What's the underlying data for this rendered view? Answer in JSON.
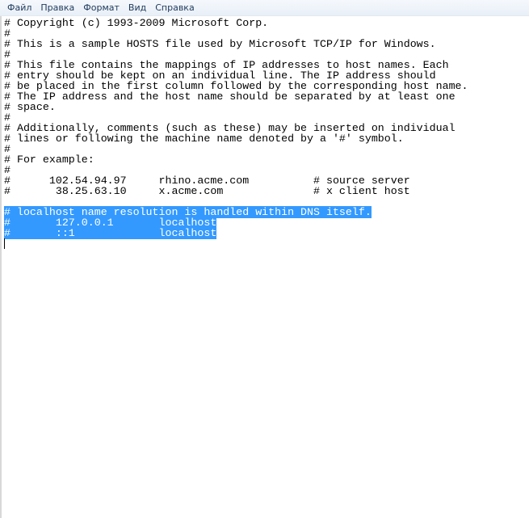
{
  "menu": [
    "Файл",
    "Правка",
    "Формат",
    "Вид",
    "Справка"
  ],
  "lines": [
    "# Copyright (c) 1993-2009 Microsoft Corp.",
    "#",
    "# This is a sample HOSTS file used by Microsoft TCP/IP for Windows.",
    "#",
    "# This file contains the mappings of IP addresses to host names. Each",
    "# entry should be kept on an individual line. The IP address should",
    "# be placed in the first column followed by the corresponding host name.",
    "# The IP address and the host name should be separated by at least one",
    "# space.",
    "#",
    "# Additionally, comments (such as these) may be inserted on individual",
    "# lines or following the machine name denoted by a '#' symbol.",
    "#",
    "# For example:",
    "#",
    "#      102.54.94.97     rhino.acme.com          # source server",
    "#       38.25.63.10     x.acme.com              # x client host",
    ""
  ],
  "selected_lines": [
    "# localhost name resolution is handled within DNS itself.",
    "#       127.0.0.1       localhost",
    "#       ::1             localhost"
  ],
  "colors": {
    "selection": "#3399ff"
  }
}
